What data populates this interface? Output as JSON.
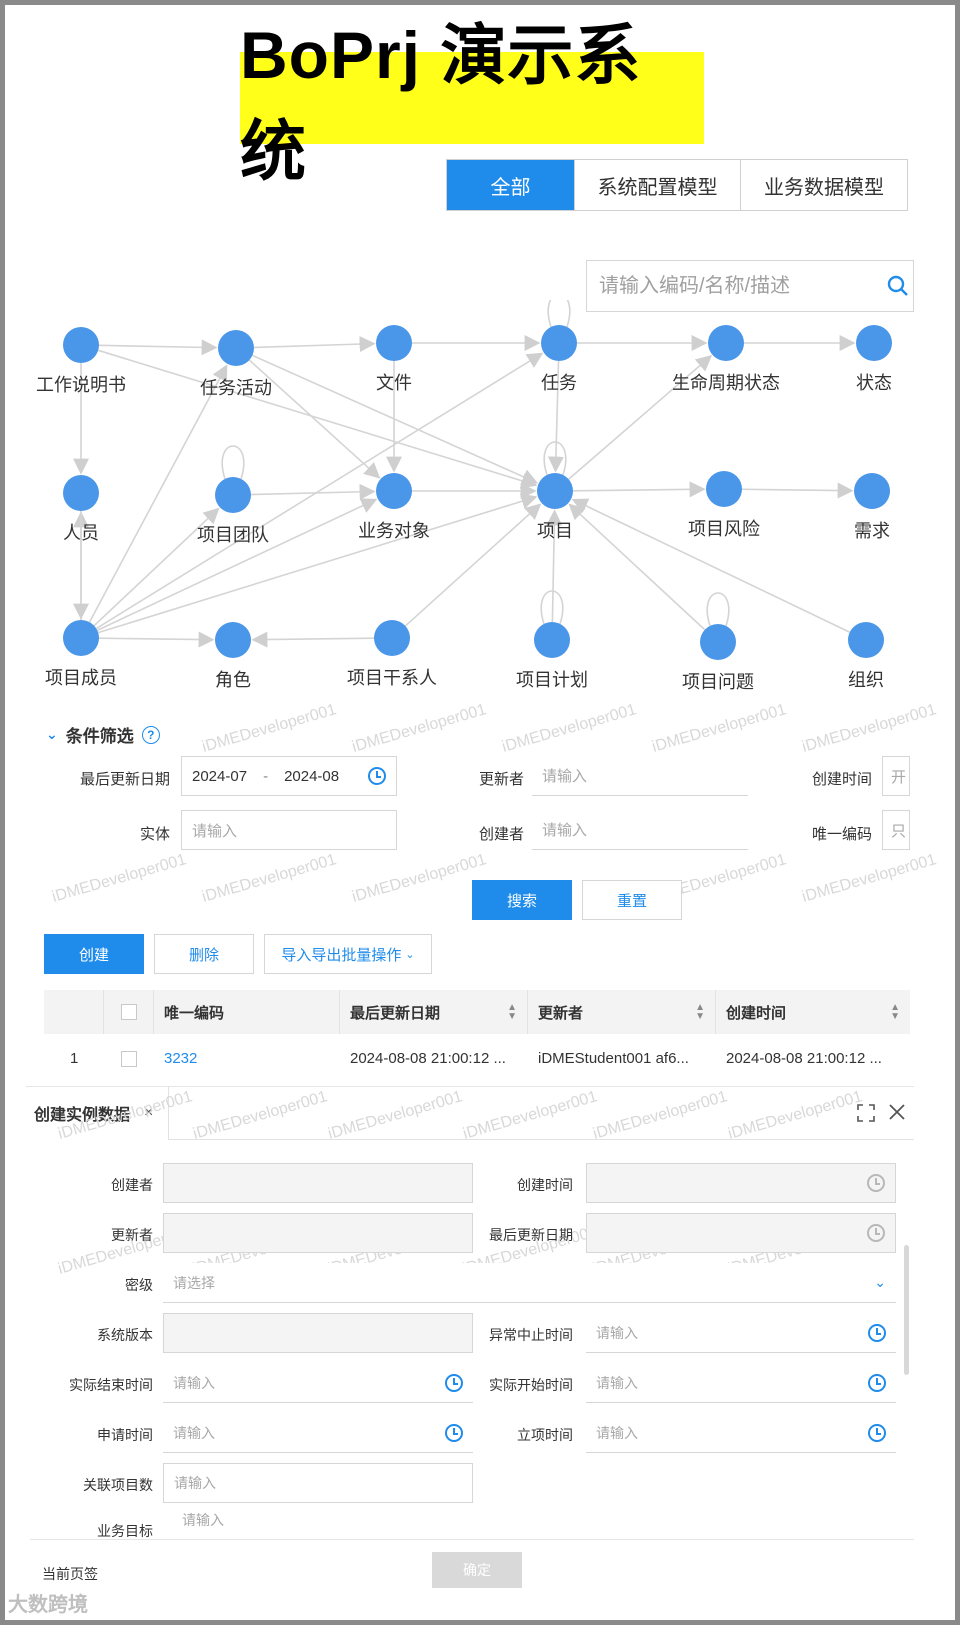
{
  "header": {
    "title": "BoPrj 演示系统"
  },
  "tabs": [
    {
      "label": "全部",
      "active": true
    },
    {
      "label": "系统配置模型",
      "active": false
    },
    {
      "label": "业务数据模型",
      "active": false
    }
  ],
  "search": {
    "placeholder": "请输入编码/名称/描述",
    "icon": "search-icon"
  },
  "graph": {
    "nodes": [
      {
        "id": "n0",
        "label": "工作说明书"
      },
      {
        "id": "n1",
        "label": "任务活动"
      },
      {
        "id": "n2",
        "label": "文件"
      },
      {
        "id": "n3",
        "label": "任务"
      },
      {
        "id": "n4",
        "label": "生命周期状态"
      },
      {
        "id": "n5",
        "label": "状态"
      },
      {
        "id": "n6",
        "label": "人员"
      },
      {
        "id": "n7",
        "label": "项目团队"
      },
      {
        "id": "n8",
        "label": "业务对象"
      },
      {
        "id": "n9",
        "label": "项目"
      },
      {
        "id": "n10",
        "label": "项目风险"
      },
      {
        "id": "n11",
        "label": "需求"
      },
      {
        "id": "n12",
        "label": "项目成员"
      },
      {
        "id": "n13",
        "label": "角色"
      },
      {
        "id": "n14",
        "label": "项目干系人"
      },
      {
        "id": "n15",
        "label": "项目计划"
      },
      {
        "id": "n16",
        "label": "项目问题"
      },
      {
        "id": "n17",
        "label": "组织"
      }
    ],
    "edges": [
      [
        "n0",
        "n1"
      ],
      [
        "n1",
        "n2"
      ],
      [
        "n2",
        "n3"
      ],
      [
        "n3",
        "n4"
      ],
      [
        "n4",
        "n5"
      ],
      [
        "n0",
        "n6"
      ],
      [
        "n7",
        "n8"
      ],
      [
        "n8",
        "n9"
      ],
      [
        "n9",
        "n10"
      ],
      [
        "n10",
        "n11"
      ],
      [
        "n12",
        "n13"
      ],
      [
        "n14",
        "n13"
      ],
      [
        "n15",
        "n9"
      ],
      [
        "n16",
        "n9"
      ],
      [
        "n17",
        "n9"
      ],
      [
        "n12",
        "n9"
      ],
      [
        "n14",
        "n9"
      ],
      [
        "n3",
        "n9"
      ],
      [
        "n0",
        "n9"
      ],
      [
        "n1",
        "n8"
      ],
      [
        "n1",
        "n9"
      ],
      [
        "n2",
        "n8"
      ],
      [
        "n12",
        "n1"
      ],
      [
        "n12",
        "n6"
      ],
      [
        "n12",
        "n3"
      ],
      [
        "n9",
        "n4"
      ],
      [
        "n12",
        "n8"
      ],
      [
        "n6",
        "n12"
      ],
      [
        "n12",
        "n7"
      ]
    ],
    "self_loops": [
      "n3",
      "n7",
      "n15",
      "n16",
      "n9"
    ]
  },
  "filter": {
    "title": "条件筛选",
    "fields": {
      "last_update_label": "最后更新日期",
      "date_start": "2024-07",
      "date_sep": "-",
      "date_end": "2024-08",
      "updater_label": "更新者",
      "updater_placeholder": "请输入",
      "created_time_label": "创建时间",
      "created_time_placeholder": "开",
      "entity_label": "实体",
      "entity_placeholder": "请输入",
      "creator_label": "创建者",
      "creator_placeholder": "请输入",
      "unique_code_label": "唯一编码",
      "unique_code_placeholder": "只"
    },
    "search_label": "搜索",
    "reset_label": "重置"
  },
  "toolbar": {
    "create_label": "创建",
    "delete_label": "删除",
    "batch_label": "导入导出批量操作"
  },
  "table": {
    "columns": [
      "唯一编码",
      "最后更新日期",
      "更新者",
      "创建时间"
    ],
    "rows": [
      {
        "index": "1",
        "code": "3232",
        "last_update": "2024-08-08 21:00:12 ...",
        "updater": "iDMEStudent001 af6...",
        "created": "2024-08-08 21:00:12 ..."
      }
    ]
  },
  "dialog": {
    "tab_label": "创建实例数据",
    "fields": {
      "creator": "创建者",
      "created_time": "创建时间",
      "updater": "更新者",
      "last_update": "最后更新日期",
      "secret_level": "密级",
      "secret_placeholder": "请选择",
      "sys_version": "系统版本",
      "abnormal_stop": "异常中止时间",
      "actual_end": "实际结束时间",
      "actual_start": "实际开始时间",
      "apply_time": "申请时间",
      "approve_time": "立项时间",
      "related_projects": "关联项目数",
      "business_goal": "业务目标",
      "placeholder": "请输入"
    },
    "footer_label": "当前页签",
    "confirm_label": "确定"
  },
  "watermark": "iDMEDeveloper001",
  "logo": "大数跨境",
  "colors": {
    "accent": "#1f8ceb",
    "banner": "#ffff19",
    "node": "#4a96e8"
  }
}
